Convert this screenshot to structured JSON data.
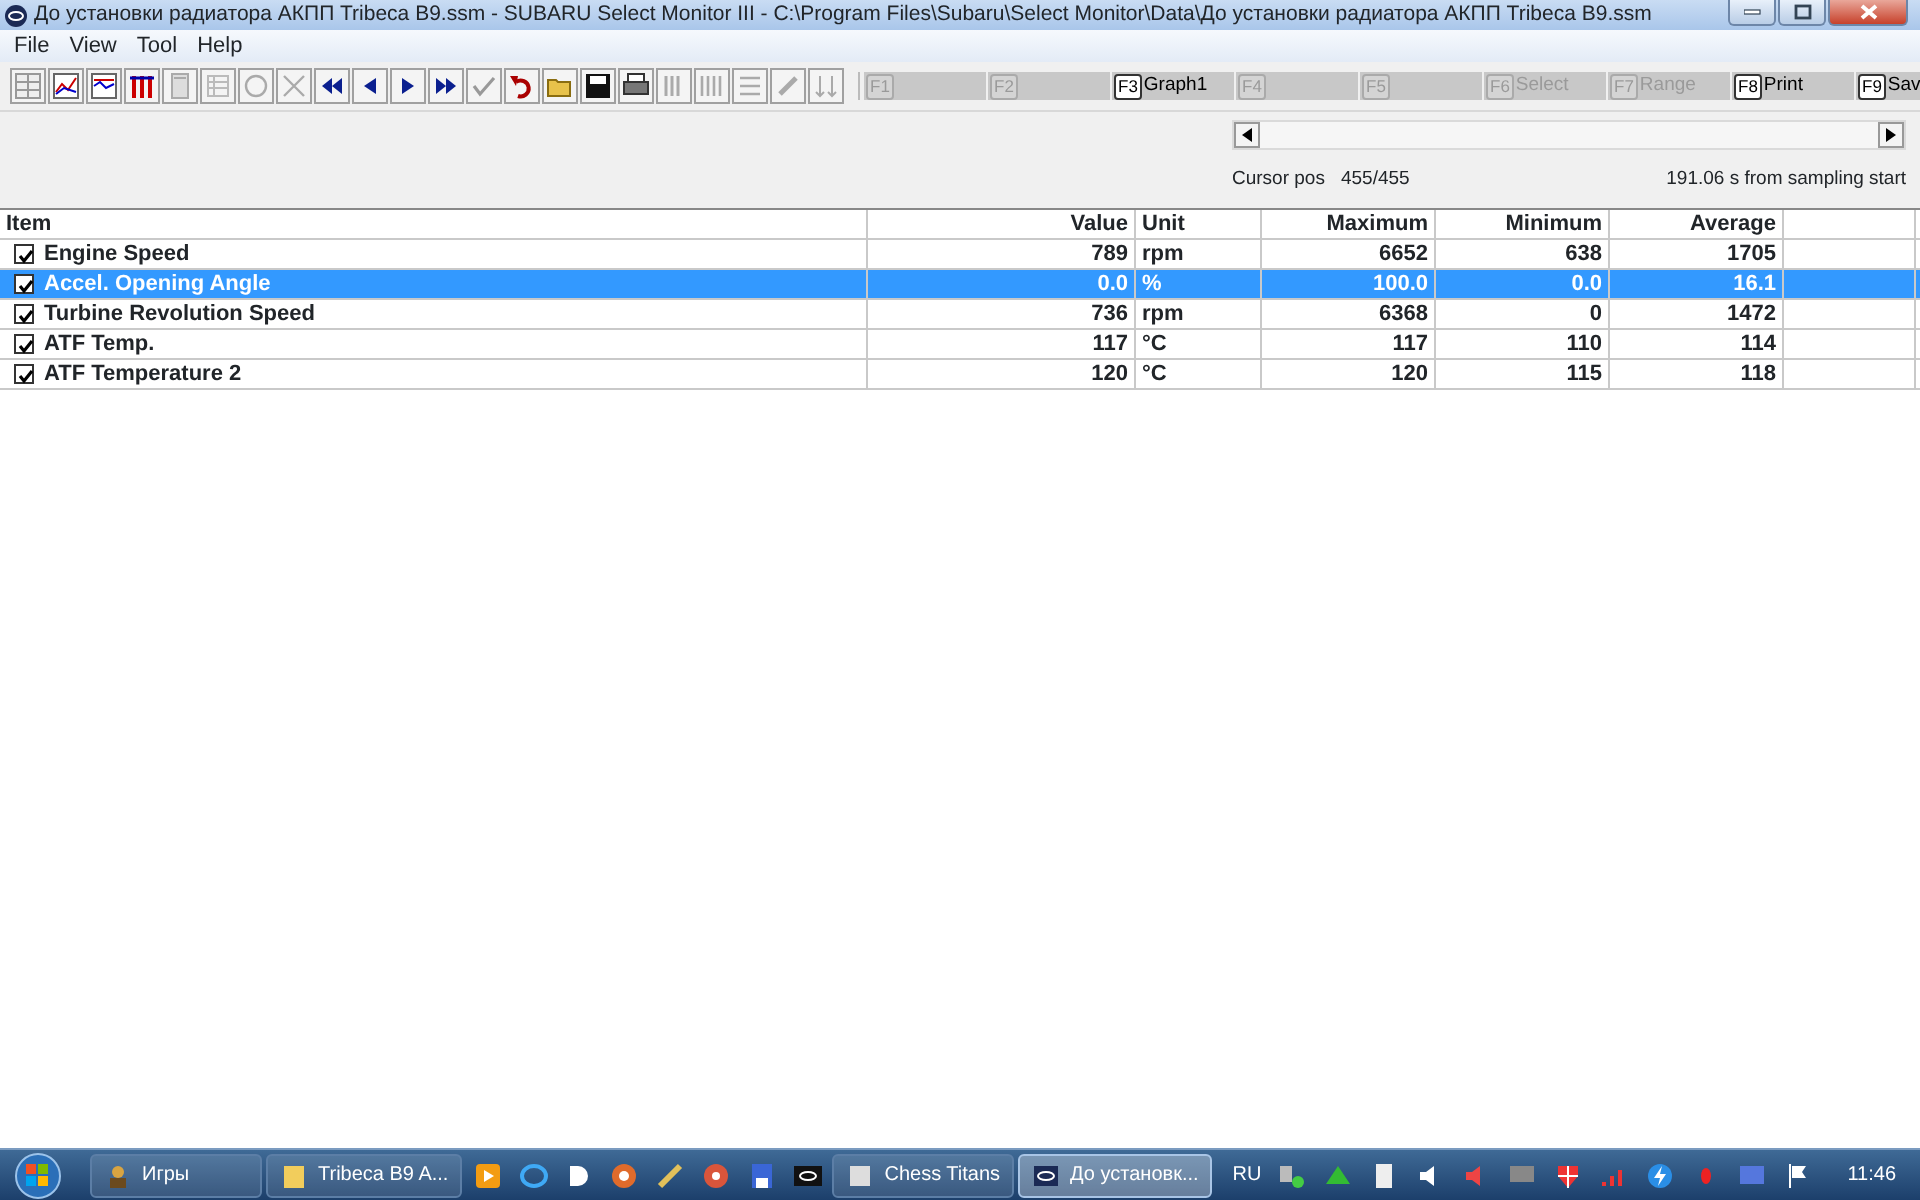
{
  "window": {
    "title": "До установки радиатора АКПП Tribeca B9.ssm - SUBARU Select Monitor III - C:\\Program Files\\Subaru\\Select Monitor\\Data\\До установки радиатора АКПП Tribeca B9.ssm"
  },
  "menu": [
    "File",
    "View",
    "Tool",
    "Help"
  ],
  "function_keys": [
    {
      "key": "F1",
      "enabled": false
    },
    {
      "key": "F2",
      "enabled": false
    },
    {
      "key": "F3",
      "label": "Graph1",
      "enabled": true
    },
    {
      "key": "F4",
      "enabled": false
    },
    {
      "key": "F5",
      "enabled": false
    },
    {
      "key": "F6",
      "label": "Select",
      "enabled": false
    },
    {
      "key": "F7",
      "label": "Range",
      "enabled": false
    },
    {
      "key": "F8",
      "label": "Print",
      "enabled": true
    },
    {
      "key": "F9",
      "label": "Sav",
      "enabled": true
    }
  ],
  "cursor": {
    "label": "Cursor pos",
    "value": "455/455",
    "time": "191.06 s from sampling start"
  },
  "table": {
    "columns": [
      "Item",
      "Value",
      "Unit",
      "Maximum",
      "Minimum",
      "Average"
    ],
    "rows": [
      {
        "checked": true,
        "selected": false,
        "cells": [
          "Engine Speed",
          "789",
          "rpm",
          "6652",
          "638",
          "1705"
        ]
      },
      {
        "checked": true,
        "selected": true,
        "cells": [
          "Accel. Opening Angle",
          "0.0",
          "%",
          "100.0",
          "0.0",
          "16.1"
        ]
      },
      {
        "checked": true,
        "selected": false,
        "cells": [
          "Turbine Revolution Speed",
          "736",
          "rpm",
          "6368",
          "0",
          "1472"
        ]
      },
      {
        "checked": true,
        "selected": false,
        "cells": [
          "ATF Temp.",
          "117",
          "°C",
          "117",
          "110",
          "114"
        ]
      },
      {
        "checked": true,
        "selected": false,
        "cells": [
          "ATF Temperature 2",
          "120",
          "°C",
          "120",
          "115",
          "118"
        ]
      }
    ]
  },
  "taskbar": {
    "buttons": [
      {
        "label": "Игры",
        "selected": false
      },
      {
        "label": "Tribeca B9 A...",
        "selected": false
      },
      {
        "label": "Chess Titans",
        "selected": false
      },
      {
        "label": "До установк...",
        "selected": true
      }
    ],
    "language": "RU",
    "clock": "11:46"
  }
}
